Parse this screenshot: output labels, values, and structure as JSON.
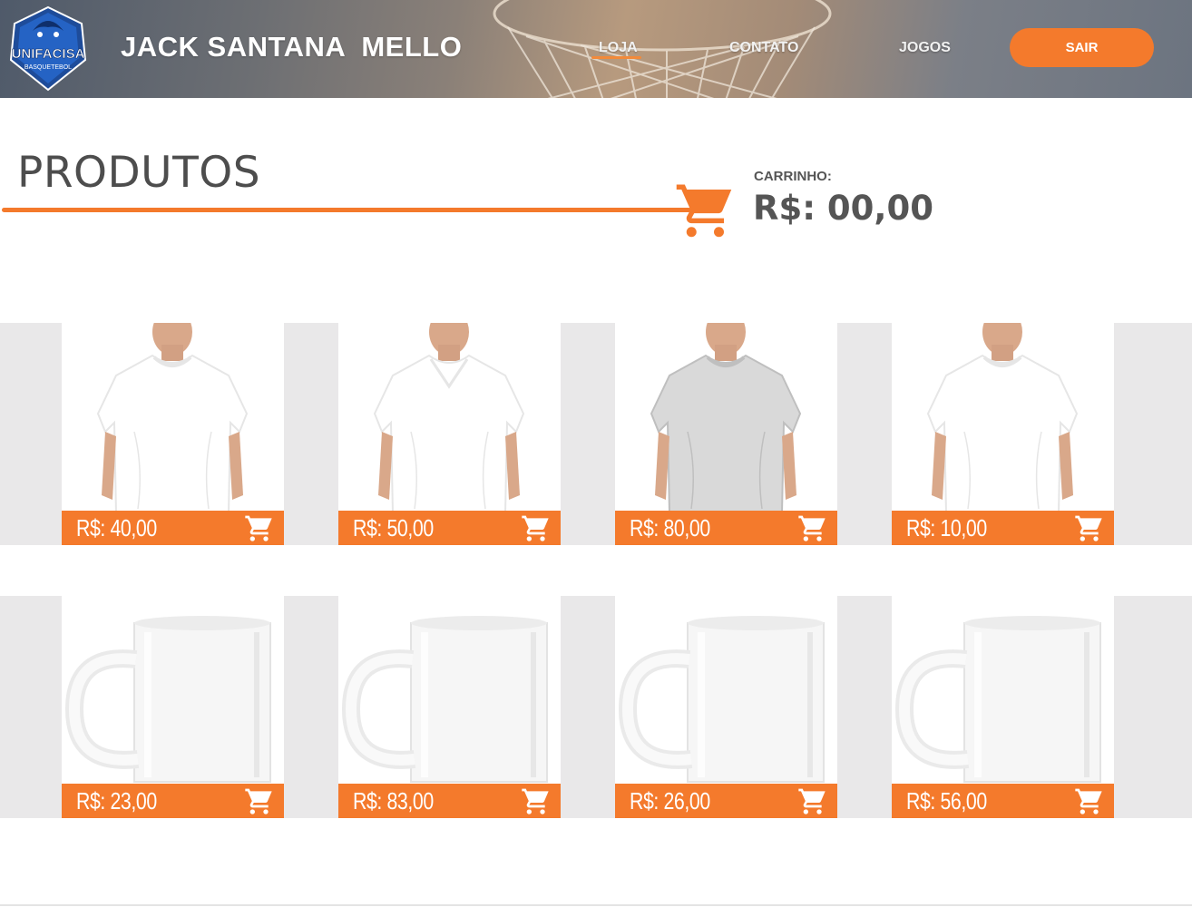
{
  "header": {
    "logo_text": "UNIFACISA",
    "logo_sub": "BASQUETEBOL",
    "user_name": "JACK SANTANA  MELLO",
    "nav": [
      {
        "label": "LOJA",
        "active": true
      },
      {
        "label": "CONTATO",
        "active": false
      },
      {
        "label": "JOGOS",
        "active": false
      }
    ],
    "logout_label": "SAIR"
  },
  "main": {
    "title": "PRODUTOS",
    "cart_label": "CARRINHO:",
    "cart_total": "R$: 00,00"
  },
  "products": [
    {
      "price": "R$: 40,00",
      "kind": "tshirt",
      "color": "#ffffff"
    },
    {
      "price": "R$: 50,00",
      "kind": "tshirt-v",
      "color": "#ffffff"
    },
    {
      "price": "R$: 80,00",
      "kind": "tshirt",
      "color": "#d9d9d9"
    },
    {
      "price": "R$: 10,00",
      "kind": "tshirt",
      "color": "#ffffff"
    },
    {
      "price": "R$: 23,00",
      "kind": "mug",
      "color": "#ffffff"
    },
    {
      "price": "R$: 83,00",
      "kind": "mug",
      "color": "#ffffff"
    },
    {
      "price": "R$: 26,00",
      "kind": "mug",
      "color": "#ffffff"
    },
    {
      "price": "R$: 56,00",
      "kind": "mug",
      "color": "#ffffff"
    }
  ],
  "colors": {
    "accent": "#f47a2c",
    "band": "#e9e8e9",
    "text": "#4d4d4d"
  },
  "icons": {
    "cart": "cart-icon",
    "logo": "unifacisa-logo"
  }
}
